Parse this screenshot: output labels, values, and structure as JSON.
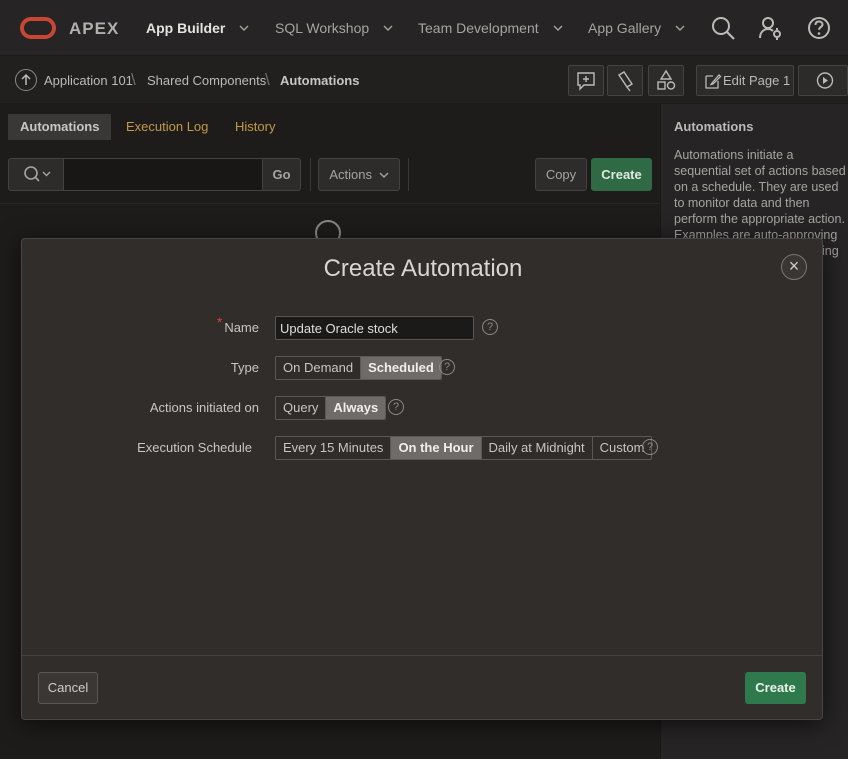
{
  "topnav": {
    "brand": "APEX",
    "items": [
      {
        "label": "App Builder",
        "active": true
      },
      {
        "label": "SQL Workshop",
        "active": false
      },
      {
        "label": "Team Development",
        "active": false
      },
      {
        "label": "App Gallery",
        "active": false
      }
    ],
    "icons": [
      "search-icon",
      "user-settings-icon",
      "help-icon"
    ],
    "brand_color": "#c74634"
  },
  "breadcrumb": {
    "items": [
      "Application 101",
      "Shared Components",
      "Automations"
    ],
    "edit_page_label": "Edit Page 1",
    "toolbar_icons": [
      "comment-add-icon",
      "flashlight-icon",
      "shapes-icon",
      "edit-icon",
      "run-icon"
    ]
  },
  "tabs": [
    {
      "label": "Automations",
      "active": true
    },
    {
      "label": "Execution Log",
      "active": false
    },
    {
      "label": "History",
      "active": false
    }
  ],
  "report_toolbar": {
    "search_value": "",
    "go_label": "Go",
    "actions_label": "Actions",
    "copy_label": "Copy",
    "create_label": "Create"
  },
  "side_panel": {
    "title": "Automations",
    "text": "Automations initiate a sequential set of actions based on a schedule. They are used to monitor data and then perform the appropriate action. Examples are auto-approving specific requests and sending"
  },
  "modal": {
    "title": "Create Automation",
    "fields": {
      "name": {
        "label": "Name",
        "value": "Update Oracle stock",
        "required": true
      },
      "type": {
        "label": "Type",
        "options": [
          "On Demand",
          "Scheduled"
        ],
        "selected": "Scheduled"
      },
      "actions_initiated_on": {
        "label": "Actions initiated on",
        "options": [
          "Query",
          "Always"
        ],
        "selected": "Always"
      },
      "execution_schedule": {
        "label": "Execution Schedule",
        "options": [
          "Every 15 Minutes",
          "On the Hour",
          "Daily at Midnight",
          "Custom"
        ],
        "selected": "On the Hour"
      }
    },
    "cancel_label": "Cancel",
    "create_label": "Create",
    "help_glyph": "?",
    "close_glyph": "×",
    "required_glyph": "*"
  },
  "colors": {
    "accent_green": "#2f7a4c",
    "link_gold": "#c39a48",
    "required_red": "#d94040"
  }
}
